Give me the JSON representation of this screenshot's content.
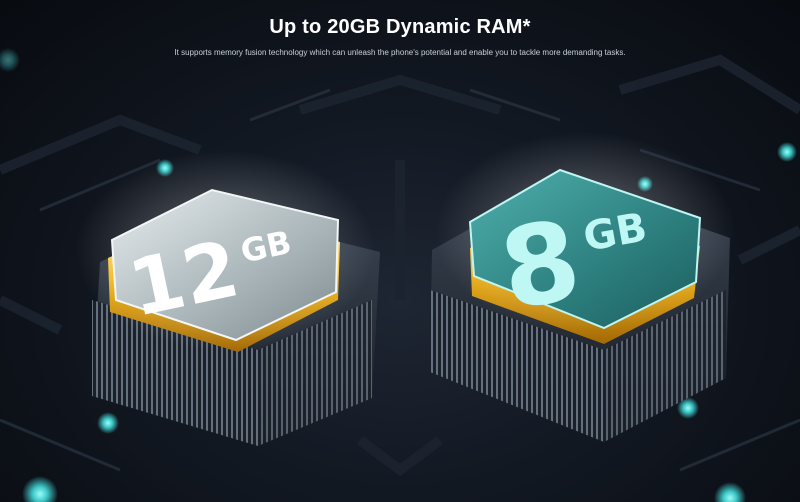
{
  "banner": {
    "headline": "Up to 20GB Dynamic RAM*",
    "subline": "It supports memory fusion technology which can unleash the phone's potential and enable you to tackle more demanding tasks."
  },
  "chips": {
    "left": {
      "number": "12",
      "unit": "GB"
    },
    "right": {
      "number": "8",
      "unit": "GB"
    }
  },
  "colors": {
    "accent_gold": "#f2b51b",
    "accent_teal": "#3ec9c9",
    "background": "#0b1018"
  }
}
